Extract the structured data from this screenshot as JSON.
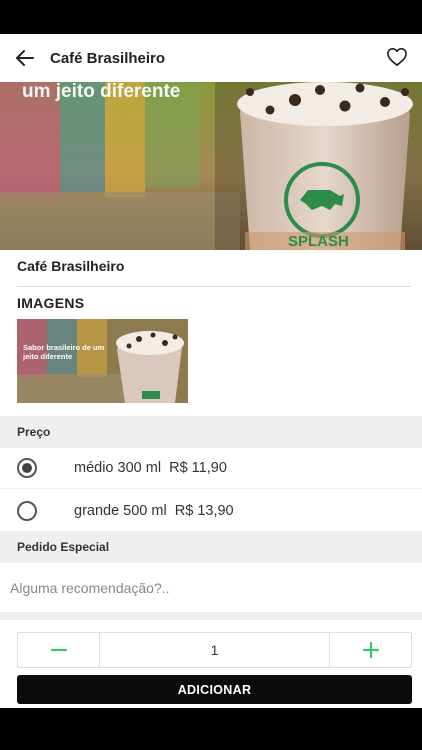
{
  "header": {
    "title": "Café Brasilheiro",
    "back_icon": "arrow-left-icon",
    "favorite_icon": "heart-outline-icon"
  },
  "hero": {
    "overlay_text": "um jeito diferente",
    "cup_logo_text": "SPLASH"
  },
  "product": {
    "name": "Café Brasilheiro"
  },
  "images_section": {
    "heading": "IMAGENS",
    "thumbnail_text": "Sabor brasileiro de um jeito diferente"
  },
  "price_section": {
    "heading": "Preço",
    "options": [
      {
        "size": "médio 300 ml",
        "price": "R$ 11,90",
        "selected": true
      },
      {
        "size": "grande 500 ml",
        "price": "R$ 13,90",
        "selected": false
      }
    ]
  },
  "special_request": {
    "heading": "Pedido Especial",
    "placeholder": "Alguma recomendação?..",
    "value": ""
  },
  "quantity": {
    "value": "1",
    "minus_icon": "minus-icon",
    "plus_icon": "plus-icon"
  },
  "add_button": {
    "label": "ADICIONAR"
  },
  "colors": {
    "accent_green": "#3ec36b",
    "button_bg": "#0b0b0b",
    "section_bg": "#efefef"
  }
}
